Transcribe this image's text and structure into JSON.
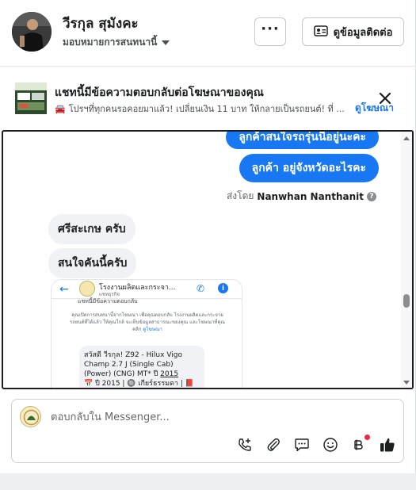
{
  "header": {
    "contact_name": "วีรกุล สุมังคะ",
    "assign_label": "มอบหมายการสนทนานี้",
    "more_label": "···",
    "view_contact_label": "ดูข้อมูลติดต่อ"
  },
  "ad_banner": {
    "title": "แชทนี้มีข้อความตอบกลับต่อโฆษณาของคุณ",
    "preview_icon": "🚘",
    "preview": "โปรฯที่ทุกคนรอคอยมาแล้ว! เปลี่ยนเงิน 11 บาท ให้กลายเป็นรถยนต์! ที่ ...",
    "link": "ดูโฆษณา"
  },
  "messages": {
    "out_1": "ลูกค้าสนใจรถรุ่นนี้อยู่นะคะ",
    "out_2": "ลูกค้า   อยู่จังหวัดอะไรคะ",
    "sent_by_prefix": "ส่งโดย",
    "sent_by_name": "Nanwhan Nanthanit",
    "in_1": "ศรีสะเกษ ครับ",
    "in_2": "สนใจคันนี้ครับ"
  },
  "screenshot": {
    "page_name": "โรงงานผลิตและกระจา...",
    "page_sub": "แชทธุรกิจ",
    "clipped_text": "แชทนี้มีข้อความตอบกลับ",
    "body": "คุณเปิดการสนทนานี้จากโฆษณา เพื่อคุณตอบกลับ โรงงานผลิตและกระจายรถยนต์ที่ได้แล้ว ให้คุณใกล้ จะเห็นข้อมูลสาธารณะของคุณ และโฆษณาที่คุณคลิก",
    "body_link": "ดูโฆษณา",
    "card_line1": "สวัสดี วีรกุล!  Z92 - Hilux Vigo",
    "card_line2": "Champ 2.7 J (Single Cab)",
    "card_line3_pre": "(Power) (CNG) MT* ปี ",
    "card_line3_year": "2015",
    "card_line4": "📅 ปี 2015 | 🔘 เกียร์ธรรมดา | 📕"
  },
  "composer": {
    "placeholder": "ตอบกลับใน Messenger..."
  },
  "icons": {
    "call": "call-icon",
    "attach": "attach-icon",
    "saved_reply": "saved-replies-icon",
    "emoji": "emoji-icon",
    "baht": "baht-icon",
    "like": "like-icon"
  },
  "colors": {
    "accent": "#1877f2",
    "bubble_in": "#f0f2f5",
    "badge": "#f02849"
  }
}
